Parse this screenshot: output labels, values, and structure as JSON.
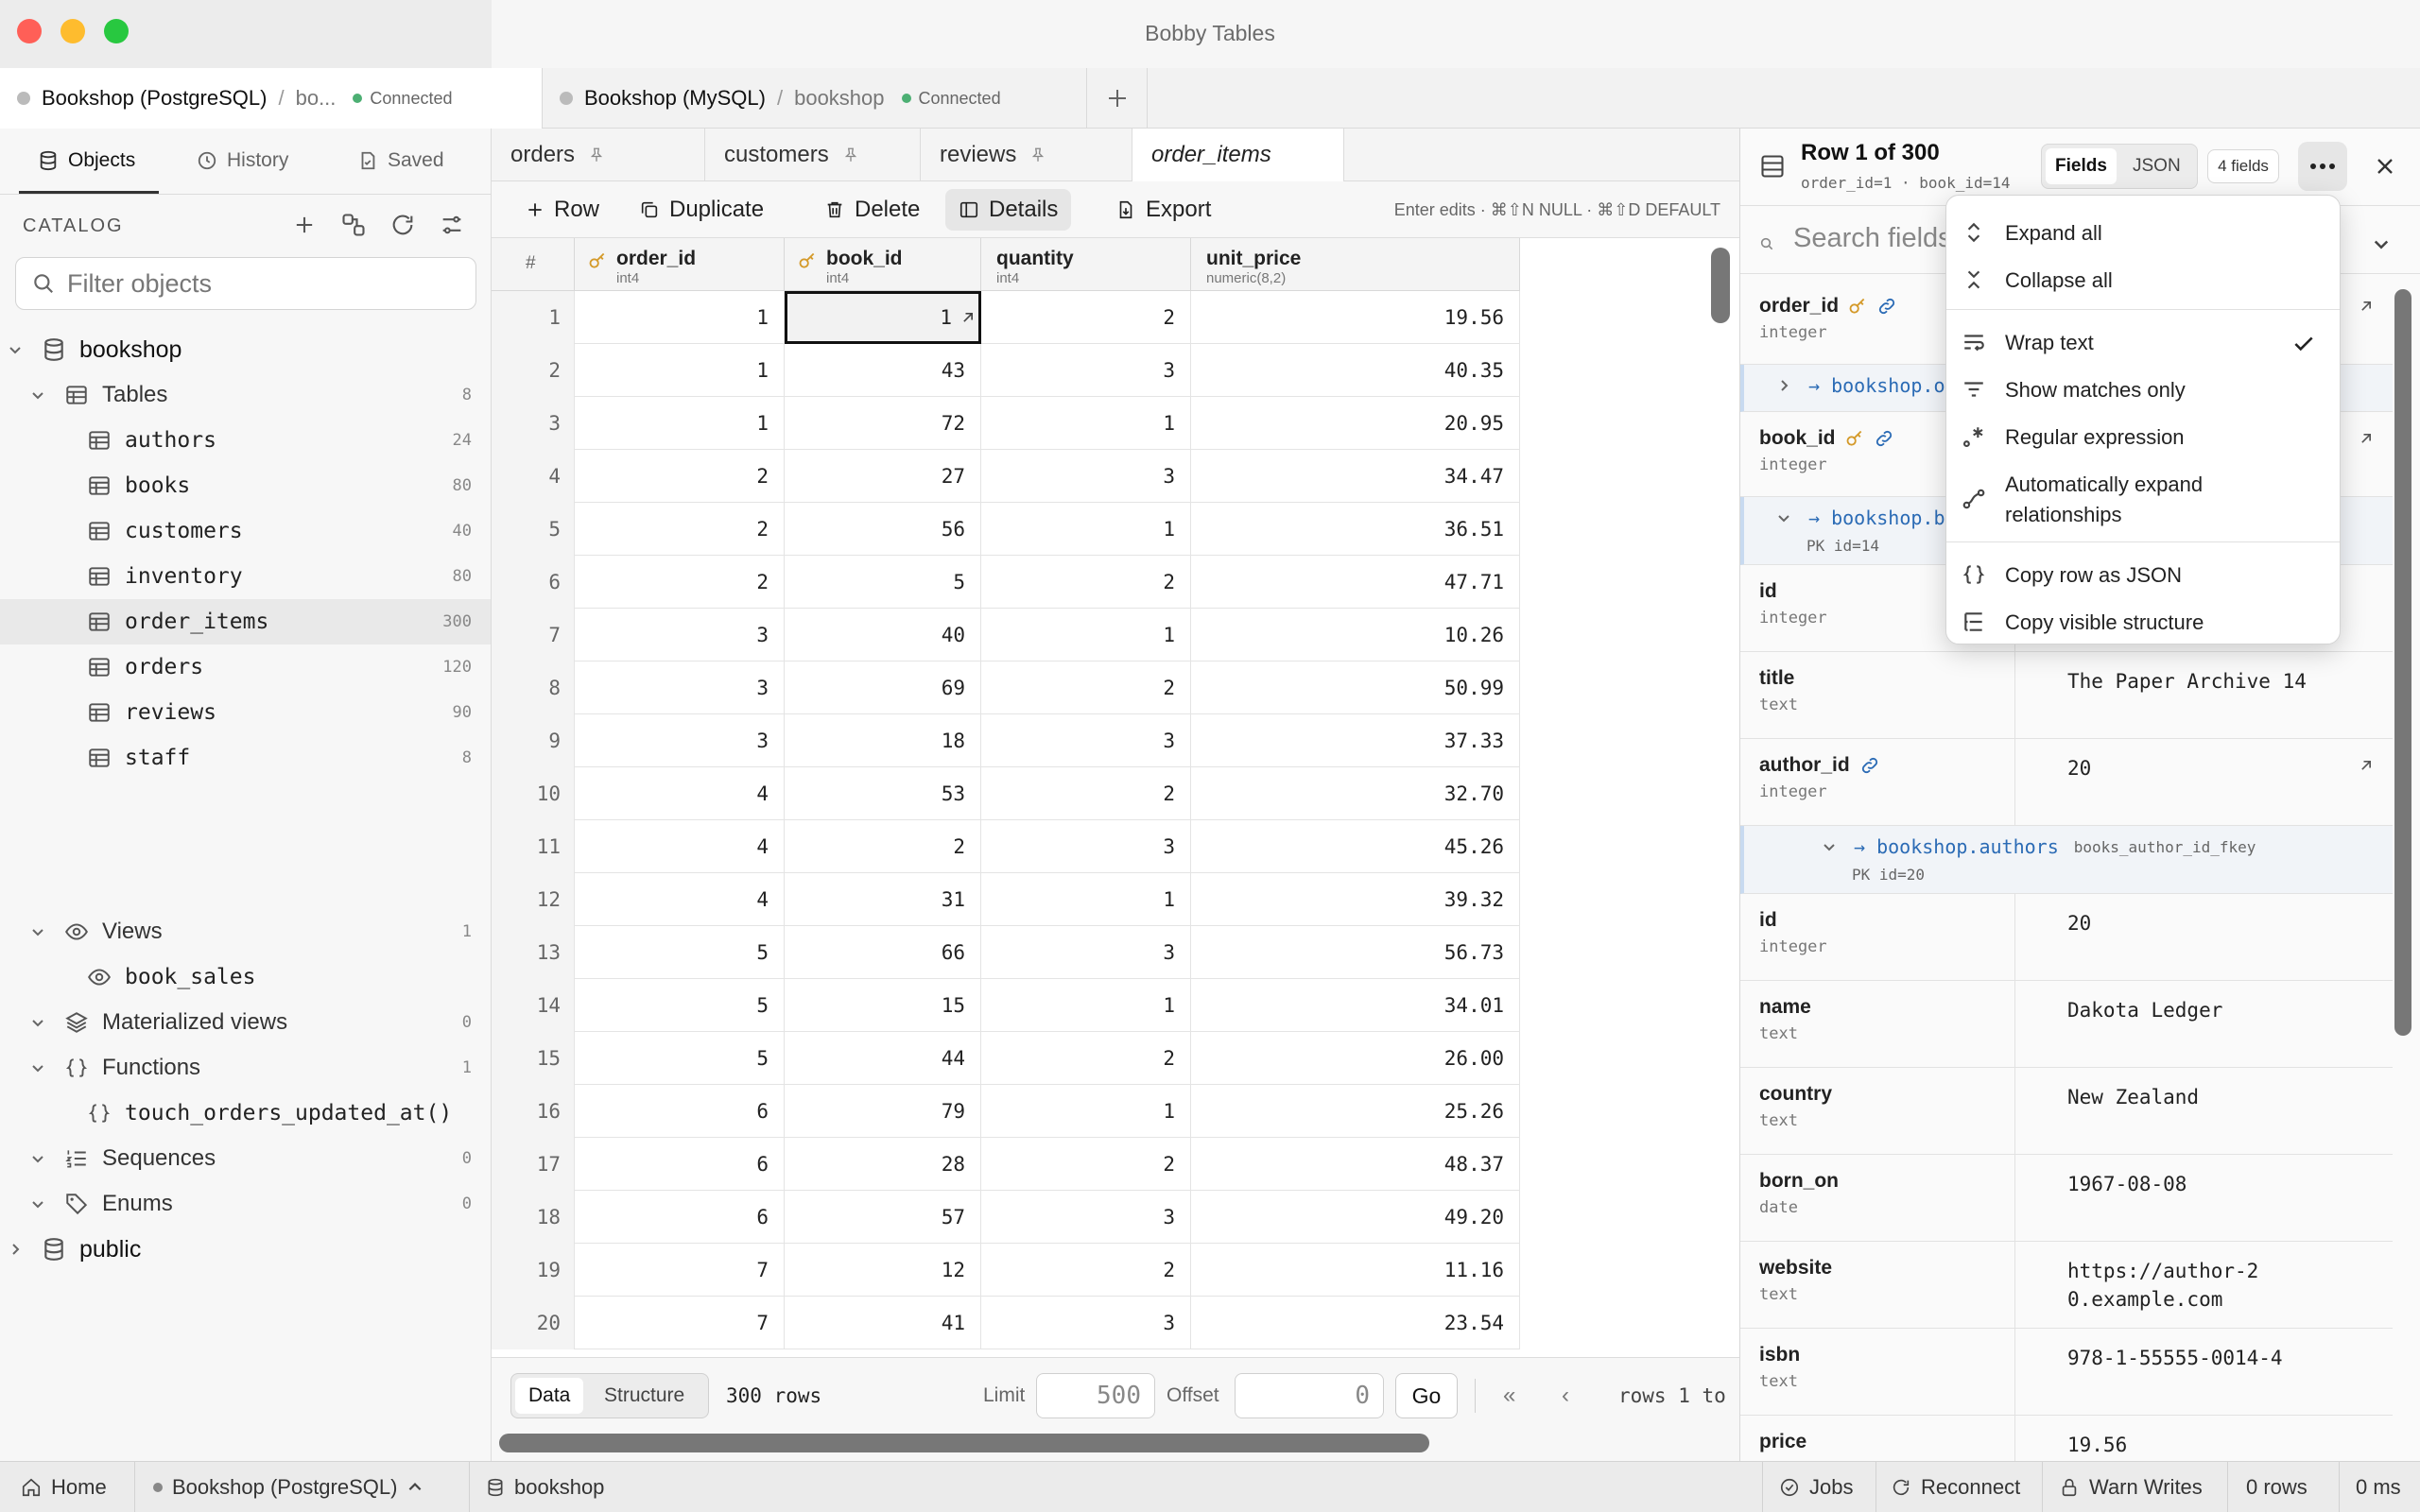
{
  "window": {
    "title": "Bobby Tables"
  },
  "connections": [
    {
      "name": "Bookshop (PostgreSQL)",
      "sep": "/",
      "db": "bo...",
      "status": "Connected"
    },
    {
      "name": "Bookshop (MySQL)",
      "sep": "/",
      "db": "bookshop",
      "status": "Connected"
    }
  ],
  "sidebar": {
    "tabs": [
      {
        "label": "Objects"
      },
      {
        "label": "History"
      },
      {
        "label": "Saved"
      }
    ],
    "catalog_label": "CATALOG",
    "filter_placeholder": "Filter objects",
    "tree": {
      "bookshop": "bookshop",
      "tables": {
        "label": "Tables",
        "count": "8"
      },
      "table_items": [
        {
          "name": "authors",
          "count": "24"
        },
        {
          "name": "books",
          "count": "80"
        },
        {
          "name": "customers",
          "count": "40"
        },
        {
          "name": "inventory",
          "count": "80"
        },
        {
          "name": "order_items",
          "count": "300"
        },
        {
          "name": "orders",
          "count": "120"
        },
        {
          "name": "reviews",
          "count": "90"
        },
        {
          "name": "staff",
          "count": "8"
        }
      ],
      "views": {
        "label": "Views",
        "count": "1"
      },
      "view_items": [
        {
          "name": "book_sales"
        }
      ],
      "matviews": {
        "label": "Materialized views",
        "count": "0"
      },
      "functions": {
        "label": "Functions",
        "count": "1"
      },
      "function_items": [
        {
          "name": "touch_orders_updated_at()"
        }
      ],
      "sequences": {
        "label": "Sequences",
        "count": "0"
      },
      "enums": {
        "label": "Enums",
        "count": "0"
      },
      "public": "public"
    }
  },
  "main": {
    "tabs": [
      {
        "label": "orders"
      },
      {
        "label": "customers"
      },
      {
        "label": "reviews"
      },
      {
        "label": "order_items"
      }
    ],
    "toolbar": {
      "row": "Row",
      "duplicate": "Duplicate",
      "delete": "Delete",
      "details": "Details",
      "export": "Export",
      "hint": "Enter edits · ⌘⇧N NULL · ⌘⇧D DEFAULT"
    },
    "grid": {
      "rownum_header": "#",
      "columns": [
        {
          "name": "order_id",
          "type": "int4"
        },
        {
          "name": "book_id",
          "type": "int4"
        },
        {
          "name": "quantity",
          "type": "int4"
        },
        {
          "name": "unit_price",
          "type": "numeric(8,2)"
        }
      ],
      "rows": [
        [
          "1",
          "1",
          "1",
          "2",
          "19.56"
        ],
        [
          "2",
          "1",
          "43",
          "3",
          "40.35"
        ],
        [
          "3",
          "1",
          "72",
          "1",
          "20.95"
        ],
        [
          "4",
          "2",
          "27",
          "3",
          "34.47"
        ],
        [
          "5",
          "2",
          "56",
          "1",
          "36.51"
        ],
        [
          "6",
          "2",
          "5",
          "2",
          "47.71"
        ],
        [
          "7",
          "3",
          "40",
          "1",
          "10.26"
        ],
        [
          "8",
          "3",
          "69",
          "2",
          "50.99"
        ],
        [
          "9",
          "3",
          "18",
          "3",
          "37.33"
        ],
        [
          "10",
          "4",
          "53",
          "2",
          "32.70"
        ],
        [
          "11",
          "4",
          "2",
          "3",
          "45.26"
        ],
        [
          "12",
          "4",
          "31",
          "1",
          "39.32"
        ],
        [
          "13",
          "5",
          "66",
          "3",
          "56.73"
        ],
        [
          "14",
          "5",
          "15",
          "1",
          "34.01"
        ],
        [
          "15",
          "5",
          "44",
          "2",
          "26.00"
        ],
        [
          "16",
          "6",
          "79",
          "1",
          "25.26"
        ],
        [
          "17",
          "6",
          "28",
          "2",
          "48.37"
        ],
        [
          "18",
          "6",
          "57",
          "3",
          "49.20"
        ],
        [
          "19",
          "7",
          "12",
          "2",
          "11.16"
        ],
        [
          "20",
          "7",
          "41",
          "3",
          "23.54"
        ]
      ]
    },
    "footer": {
      "data": "Data",
      "structure": "Structure",
      "row_count": "300 rows",
      "limit_label": "Limit",
      "limit": "500",
      "offset_label": "Offset",
      "offset": "0",
      "go": "Go",
      "first": "«",
      "prev": "‹",
      "range": "rows 1 to"
    }
  },
  "details": {
    "title": "Row 1 of 300",
    "subtitle": "order_id=1 · book_id=14",
    "view_fields": "Fields",
    "view_json": "JSON",
    "fields_count": "4 fields",
    "search_placeholder": "Search fields",
    "fields": {
      "order_id": {
        "name": "order_id",
        "type": "integer"
      },
      "rel_orders": {
        "link": "→ bookshop.o"
      },
      "book_id": {
        "name": "book_id",
        "type": "integer"
      },
      "rel_books": {
        "link": "→ bookshop.b",
        "pk": "PK id=14"
      },
      "id": {
        "name": "id",
        "type": "integer"
      },
      "title": {
        "name": "title",
        "type": "text",
        "value": "The Paper Archive 14"
      },
      "author_id": {
        "name": "author_id",
        "type": "integer",
        "value": "20"
      },
      "rel_authors": {
        "link": "→ bookshop.authors",
        "fk": "books_author_id_fkey",
        "pk": "PK id=20"
      },
      "a_id": {
        "name": "id",
        "type": "integer",
        "value": "20"
      },
      "a_name": {
        "name": "name",
        "type": "text",
        "value": "Dakota Ledger"
      },
      "a_country": {
        "name": "country",
        "type": "text",
        "value": "New Zealand"
      },
      "a_born": {
        "name": "born_on",
        "type": "date",
        "value": "1967-08-08"
      },
      "a_website": {
        "name": "website",
        "type": "text",
        "value": "https://author-20.example.com"
      },
      "isbn": {
        "name": "isbn",
        "type": "text",
        "value": "978-1-55555-0014-4"
      },
      "price": {
        "name": "price",
        "value": "19.56"
      }
    },
    "menu": {
      "expand_all": "Expand all",
      "collapse_all": "Collapse all",
      "wrap_text": "Wrap text",
      "show_matches": "Show matches only",
      "regex": "Regular expression",
      "auto_expand": "Automatically expand relationships",
      "copy_json": "Copy row as JSON",
      "copy_structure": "Copy visible structure"
    }
  },
  "statusbar": {
    "home": "Home",
    "connection": "Bookshop (PostgreSQL)",
    "database": "bookshop",
    "jobs": "Jobs",
    "reconnect": "Reconnect",
    "warn_writes": "Warn Writes",
    "rows": "0 rows",
    "time": "0 ms"
  },
  "colors": {
    "connected": "#4caf73",
    "link": "#2b6bb5",
    "key": "#d49a2a",
    "close": "#ff5f57",
    "minimize": "#febc2e",
    "zoom": "#28c840"
  }
}
